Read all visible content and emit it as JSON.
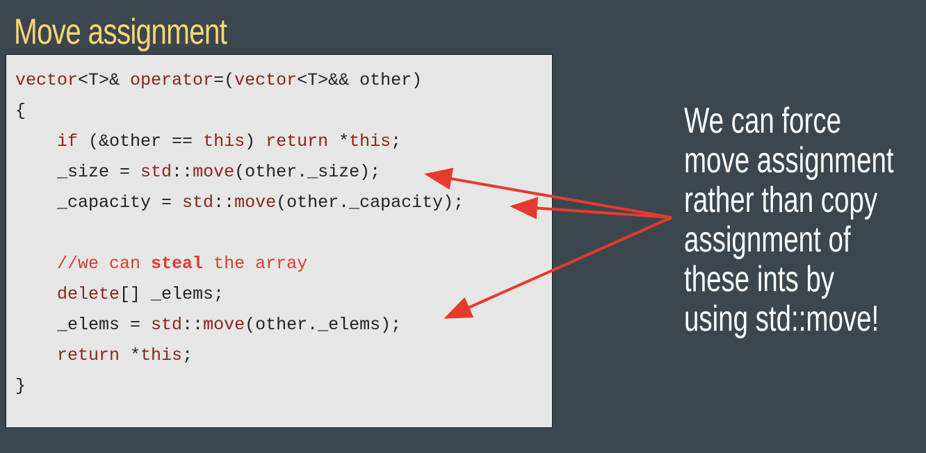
{
  "slide": {
    "title": "Move assignment",
    "title_color": "#f7d774",
    "background": "#3b464e"
  },
  "code": {
    "background": "#e6e6e6",
    "colors": {
      "plain": "#222222",
      "keyword": "#8b2518",
      "comment": "#e03a2d"
    },
    "lines": [
      [
        {
          "t": "vector",
          "k": "kw"
        },
        {
          "t": "<T>& ",
          "k": "plain"
        },
        {
          "t": "operator",
          "k": "kw"
        },
        {
          "t": "=(",
          "k": "plain"
        },
        {
          "t": "vector",
          "k": "kw"
        },
        {
          "t": "<T>&& other)",
          "k": "plain"
        }
      ],
      [
        {
          "t": "{",
          "k": "plain"
        }
      ],
      [
        {
          "t": "    ",
          "k": "plain"
        },
        {
          "t": "if",
          "k": "kw"
        },
        {
          "t": " (&other == ",
          "k": "plain"
        },
        {
          "t": "this",
          "k": "kw"
        },
        {
          "t": ") ",
          "k": "plain"
        },
        {
          "t": "return",
          "k": "kw"
        },
        {
          "t": " *",
          "k": "plain"
        },
        {
          "t": "this",
          "k": "kw"
        },
        {
          "t": ";",
          "k": "plain"
        }
      ],
      [
        {
          "t": "    _size = ",
          "k": "plain"
        },
        {
          "t": "std",
          "k": "kw"
        },
        {
          "t": "::",
          "k": "plain"
        },
        {
          "t": "move",
          "k": "kw"
        },
        {
          "t": "(other._size);",
          "k": "plain"
        }
      ],
      [
        {
          "t": "    _capacity = ",
          "k": "plain"
        },
        {
          "t": "std",
          "k": "kw"
        },
        {
          "t": "::",
          "k": "plain"
        },
        {
          "t": "move",
          "k": "kw"
        },
        {
          "t": "(other._capacity);",
          "k": "plain"
        }
      ],
      [],
      [
        {
          "t": "    ",
          "k": "plain"
        },
        {
          "t": "//we can ",
          "k": "comment"
        },
        {
          "t": "steal",
          "k": "bold"
        },
        {
          "t": " the array",
          "k": "comment"
        }
      ],
      [
        {
          "t": "    ",
          "k": "plain"
        },
        {
          "t": "delete",
          "k": "kw"
        },
        {
          "t": "[] _elems;",
          "k": "plain"
        }
      ],
      [
        {
          "t": "    _elems = ",
          "k": "plain"
        },
        {
          "t": "std",
          "k": "kw"
        },
        {
          "t": "::",
          "k": "plain"
        },
        {
          "t": "move",
          "k": "kw"
        },
        {
          "t": "(other._elems);",
          "k": "plain"
        }
      ],
      [
        {
          "t": "    ",
          "k": "plain"
        },
        {
          "t": "return",
          "k": "kw"
        },
        {
          "t": " *",
          "k": "plain"
        },
        {
          "t": "this",
          "k": "kw"
        },
        {
          "t": ";",
          "k": "plain"
        }
      ],
      [
        {
          "t": "}",
          "k": "plain"
        }
      ]
    ]
  },
  "note": {
    "lines": [
      "We can force",
      "move assignment",
      "rather than copy",
      "assignment of",
      "these ints by",
      "using std::move!"
    ],
    "color": "#ffffff"
  },
  "arrows": {
    "color": "#e63a2e",
    "count": 3
  }
}
